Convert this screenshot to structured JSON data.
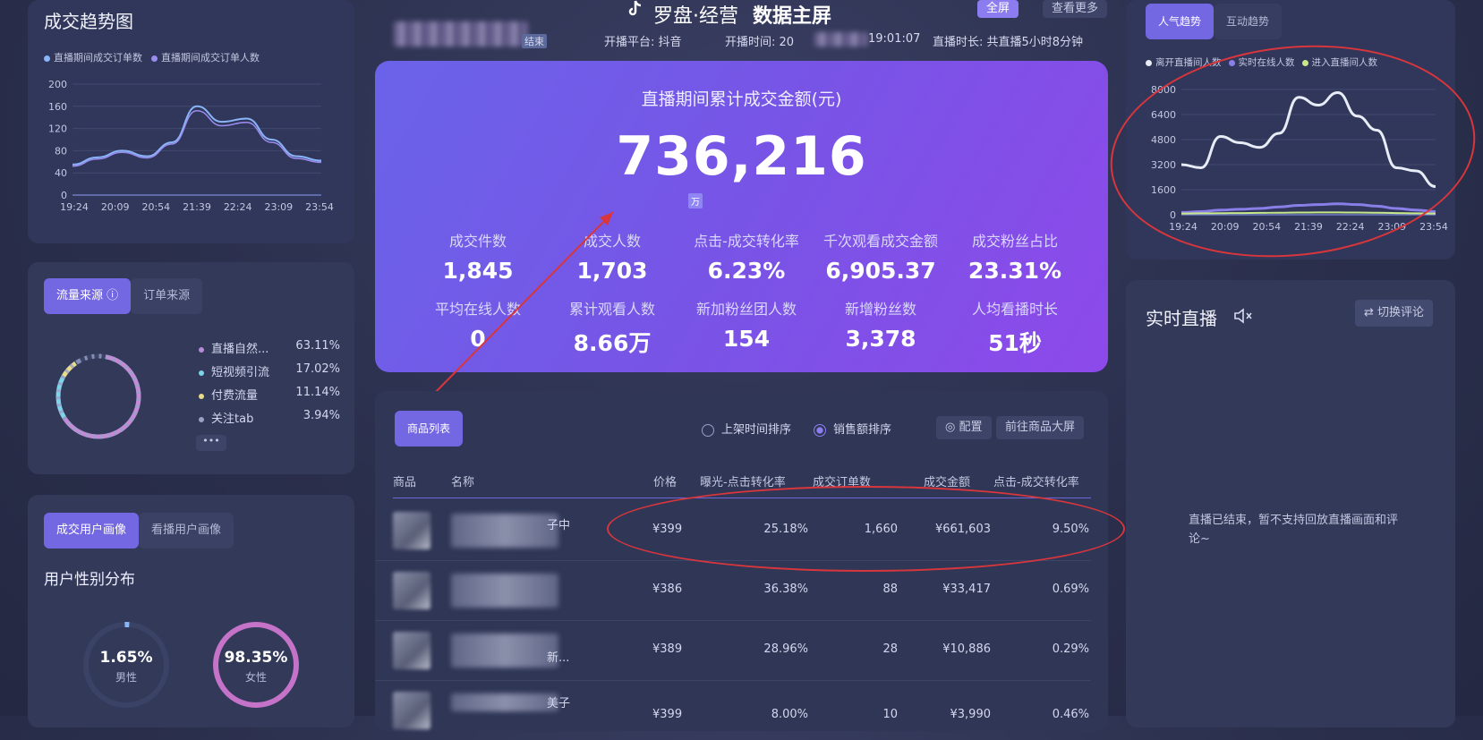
{
  "header": {
    "brand": "罗盘·经营",
    "screen_title": "数据主屏",
    "fullscreen_btn": "全屏",
    "more_btn": "查看更多",
    "status_tag": "结束",
    "platform": "开播平台: 抖音",
    "start_time": "开播时间: 20",
    "start_time_tail": "19:01:07",
    "duration": "直播时长: 共直播5小时8分钟"
  },
  "left_trend": {
    "title": "成交趋势图",
    "legend": [
      "直播期间成交订单数",
      "直播期间成交订单人数"
    ],
    "colors": [
      "#8ab4f8",
      "#9b8cf0"
    ]
  },
  "chart_data": [
    {
      "type": "line",
      "x": [
        "19:24",
        "20:09",
        "20:54",
        "21:39",
        "22:24",
        "23:09",
        "23:54"
      ],
      "y_ticks": [
        0,
        40,
        80,
        120,
        160,
        200
      ],
      "ylim": [
        0,
        200
      ],
      "series": [
        {
          "name": "直播期间成交订单数",
          "values": [
            55,
            68,
            80,
            70,
            95,
            160,
            132,
            138,
            100,
            70,
            62
          ]
        },
        {
          "name": "直播期间成交订单人数",
          "values": [
            52,
            65,
            77,
            67,
            92,
            152,
            125,
            131,
            95,
            66,
            59
          ]
        }
      ]
    },
    {
      "type": "line",
      "x": [
        "19:24",
        "20:09",
        "20:54",
        "21:39",
        "22:24",
        "23:09",
        "23:54"
      ],
      "y_ticks": [
        0,
        1600,
        3200,
        4800,
        6400,
        8000
      ],
      "ylim": [
        0,
        8000
      ],
      "series": [
        {
          "name": "离开直播间人数",
          "values": [
            3200,
            3000,
            5000,
            4600,
            4300,
            5200,
            7500,
            7000,
            7800,
            6300,
            5400,
            3000,
            2800,
            1800
          ]
        },
        {
          "name": "实时在线人数",
          "values": [
            150,
            200,
            300,
            350,
            400,
            500,
            600,
            650,
            700,
            650,
            550,
            400,
            300,
            200
          ]
        },
        {
          "name": "进入直播间人数",
          "values": [
            80,
            90,
            100,
            110,
            120,
            130,
            140,
            150,
            150,
            140,
            130,
            110,
            90,
            80
          ]
        }
      ]
    }
  ],
  "traffic": {
    "tabs": [
      "流量来源",
      "订单来源"
    ],
    "items": [
      {
        "label": "直播自然...",
        "pct": "63.11%",
        "color": "#b98ad8"
      },
      {
        "label": "短视频引流",
        "pct": "17.02%",
        "color": "#7fd3e8"
      },
      {
        "label": "付费流量",
        "pct": "11.14%",
        "color": "#e8dc8a"
      },
      {
        "label": "关注tab",
        "pct": "3.94%",
        "color": "#9aa0c8"
      }
    ],
    "more": "•••"
  },
  "user": {
    "tabs": [
      "成交用户画像",
      "看播用户画像"
    ],
    "section_title": "用户性别分布",
    "male_pct": "1.65%",
    "male_label": "男性",
    "female_pct": "98.35%",
    "female_label": "女性"
  },
  "hero": {
    "title": "直播期间累计成交金额(元)",
    "total": "736,216",
    "unit": "万",
    "stats": [
      {
        "label": "成交件数",
        "value": "1,845"
      },
      {
        "label": "成交人数",
        "value": "1,703"
      },
      {
        "label": "点击-成交转化率",
        "value": "6.23%"
      },
      {
        "label": "千次观看成交金额",
        "value": "6,905.37"
      },
      {
        "label": "成交粉丝占比",
        "value": "23.31%"
      },
      {
        "label": "平均在线人数",
        "value": "0"
      },
      {
        "label": "累计观看人数",
        "value": "8.66万"
      },
      {
        "label": "新加粉丝团人数",
        "value": "154"
      },
      {
        "label": "新增粉丝数",
        "value": "3,378"
      },
      {
        "label": "人均看播时长",
        "value": "51秒"
      }
    ]
  },
  "products": {
    "tab": "商品列表",
    "sort_options": [
      "上架时间排序",
      "销售额排序"
    ],
    "config_btn": "配置",
    "goto_btn": "前往商品大屏",
    "columns": [
      "商品",
      "名称",
      "价格",
      "曝光-点击转化率",
      "成交订单数",
      "成交金额",
      "点击-成交转化率"
    ],
    "rows": [
      {
        "name_tail": "子中",
        "price": "¥399",
        "ctr": "25.18%",
        "orders": "1,660",
        "amount": "¥661,603",
        "cvr": "9.50%"
      },
      {
        "name_tail": "",
        "price": "¥386",
        "ctr": "36.38%",
        "orders": "88",
        "amount": "¥33,417",
        "cvr": "0.69%"
      },
      {
        "name_tail": "新...",
        "price": "¥389",
        "ctr": "28.96%",
        "orders": "28",
        "amount": "¥10,886",
        "cvr": "0.29%"
      },
      {
        "name_tail": "美子",
        "price": "¥399",
        "ctr": "8.00%",
        "orders": "10",
        "amount": "¥3,990",
        "cvr": "0.46%"
      }
    ]
  },
  "popularity": {
    "tabs": [
      "人气趋势",
      "互动趋势"
    ],
    "legend": [
      "离开直播间人数",
      "实时在线人数",
      "进入直播间人数"
    ],
    "colors": [
      "#e8ecf6",
      "#8a7fe8",
      "#c8e88a"
    ]
  },
  "live": {
    "title": "实时直播",
    "mute_icon": "speaker-mute-icon",
    "switch_btn": "切换评论",
    "ended_msg": "直播已结束，暂不支持回放直播画面和评论~"
  }
}
